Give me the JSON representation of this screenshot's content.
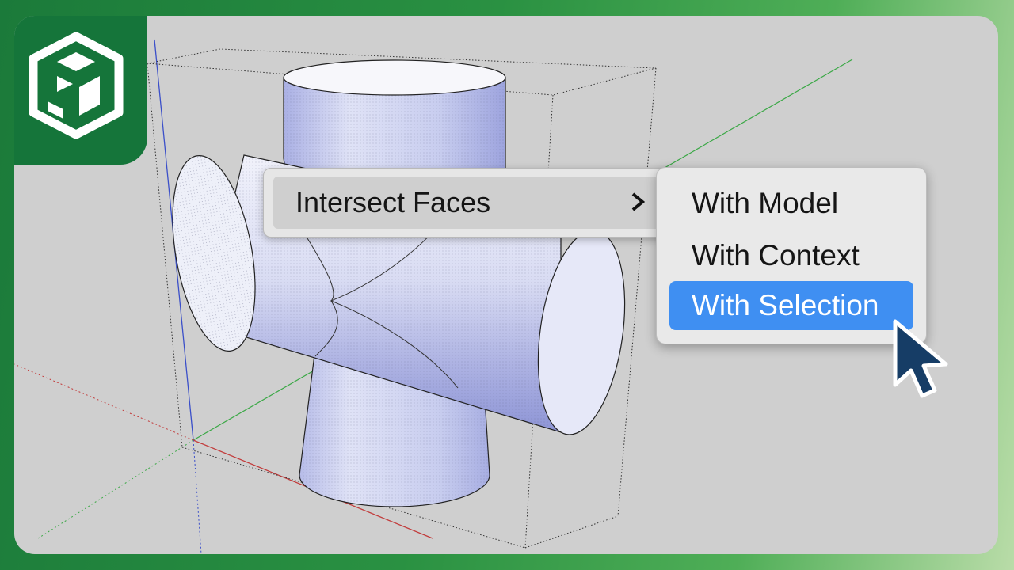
{
  "brand": {
    "logo": "sketchup-logo-icon",
    "colors": {
      "tab": "#15753a",
      "highlight": "#3f8ff2",
      "cursor": "#163d66"
    }
  },
  "viewport": {
    "model": "cross-shaped intersecting cylinders inside dotted bounding box",
    "axes": {
      "red": "#c23b3b",
      "green": "#3aa845",
      "blue": "#3b4fc9"
    }
  },
  "context_menu": {
    "item_label": "Intersect Faces",
    "submenu_icon": "chevron-right-icon"
  },
  "submenu": {
    "items": [
      {
        "label": "With Model"
      },
      {
        "label": "With Context"
      },
      {
        "label": "With Selection"
      }
    ],
    "selected": "With Selection"
  },
  "cursor": {
    "icon": "arrow-pointer-icon"
  }
}
